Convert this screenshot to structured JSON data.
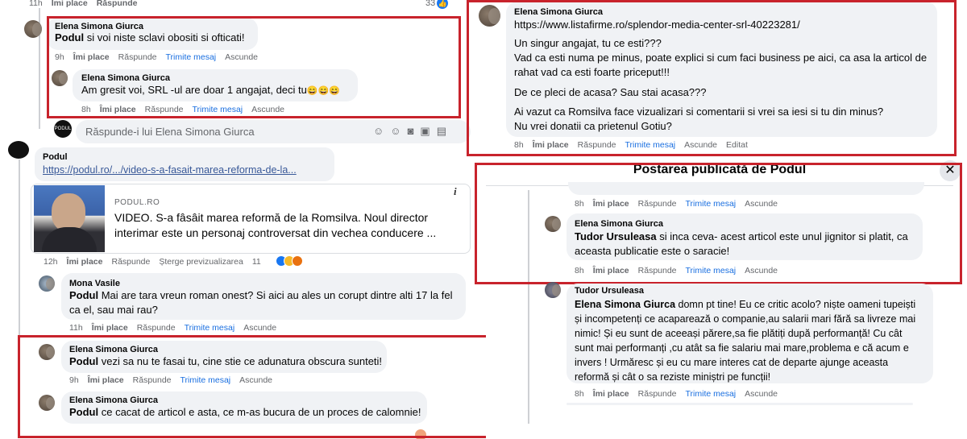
{
  "top": {
    "time": "11h",
    "like": "Îmi place",
    "reply": "Răspunde",
    "count": "33"
  },
  "c1": {
    "name": "Elena Simona Giurca",
    "tag": "Podul",
    "text": " si voi niste sclavi obositi si ofticati!",
    "time": "9h",
    "like": "Îmi place",
    "reply": "Răspunde",
    "msg": "Trimite mesaj",
    "hide": "Ascunde"
  },
  "c2": {
    "name": "Elena Simona Giurca",
    "text": "Am gresit voi, SRL -ul are doar 1 angajat, deci tu",
    "emoji": "😄😄😄",
    "time": "8h",
    "like": "Îmi place",
    "reply": "Răspunde",
    "msg": "Trimite mesaj",
    "hide": "Ascunde"
  },
  "replyBox": {
    "placeholder": "Răspunde-i lui Elena Simona Giurca"
  },
  "podul": {
    "name": "Podul",
    "url": "https://podul.ro/.../video-s-a-fasait-marea-reforma-de-la...",
    "domain": "PODUL.RO",
    "title1": "VIDEO. S-a fâsâit marea reformă de la Romsilva. Noul director",
    "title2": "interimar este un personaj controversat din vechea conducere ...",
    "info": "i",
    "time": "12h",
    "like": "Îmi place",
    "reply": "Răspunde",
    "remove": "Șterge previzualizarea",
    "count": "11"
  },
  "c3": {
    "name": "Mona Vasile",
    "tag": "Podul",
    "line1": " Mai are tara vreun roman onest? Si aici au ales un corupt dintre alti 17 la fel",
    "line2": "ca el, sau mai rau?",
    "time": "11h",
    "like": "Îmi place",
    "reply": "Răspunde",
    "msg": "Trimite mesaj",
    "hide": "Ascunde"
  },
  "c4": {
    "name": "Elena Simona Giurca",
    "tag": "Podul",
    "text": " vezi sa nu te fasai tu, cine stie ce adunatura obscura sunteti!",
    "time": "9h",
    "like": "Îmi place",
    "reply": "Răspunde",
    "msg": "Trimite mesaj",
    "hide": "Ascunde"
  },
  "c5": {
    "name": "Elena Simona Giurca",
    "tag": "Podul",
    "text": " ce cacat de articol e asta, ce m-as bucura de un proces de calomnie!"
  },
  "r1": {
    "name": "Elena Simona Giurca",
    "link": "https://www.listafirme.ro/splendor-media-center-srl-40223281/",
    "l1": "Un singur angajat, tu ce esti???",
    "l2": "Vad ca esti numa pe minus, poate explici si cum faci business pe aici, ca asa la articol de",
    "l3": "rahat vad ca esti foarte priceput!!!",
    "l4": "De ce pleci de acasa? Sau stai acasa???",
    "l5": "Ai vazut ca Romsilva face vizualizari si comentarii si vrei sa iesi si tu din minus?",
    "l6": "Nu vrei donatii ca prietenul Gotiu?",
    "time": "8h",
    "like": "Îmi place",
    "reply": "Răspunde",
    "msg": "Trimite mesaj",
    "hide": "Ascunde",
    "edited": "Editat"
  },
  "dialog": {
    "title": "Postarea publicată de Podul",
    "close": "✕"
  },
  "r2": {
    "time": "8h",
    "like": "Îmi place",
    "reply": "Răspunde",
    "msg": "Trimite mesaj",
    "hide": "Ascunde"
  },
  "r3": {
    "name": "Elena Simona Giurca",
    "tag": "Tudor Ursuleasa",
    "l1": " si inca ceva- acest articol este unul jignitor si platit, ca",
    "l2": "aceasta publicatie este o saracie!",
    "time": "8h",
    "like": "Îmi place",
    "reply": "Răspunde",
    "msg": "Trimite mesaj",
    "hide": "Ascunde"
  },
  "r4": {
    "name": "Tudor Ursuleasa",
    "tag": "Elena Simona Giurca",
    "l1": " domn pt tine! Eu ce critic acolo? niște oameni tupeiști",
    "l2": "și incompetenți ce acaparează o companie,au salarii mari fără sa livreze mai",
    "l3": "nimic! Și eu sunt de aceeași părere,sa fie plătiți după performanță! Cu cât",
    "l4": "sunt mai performanți ,cu atât sa fie salariu mai mare,problema e că acum e",
    "l5": "invers ! Urmăresc și eu cu mare interes cat de departe ajunge aceasta",
    "l6": "reformă și cât o sa reziste miniștri pe funcții!",
    "time": "8h",
    "like": "Îmi place",
    "reply": "Răspunde",
    "msg": "Trimite mesaj",
    "hide": "Ascunde"
  }
}
